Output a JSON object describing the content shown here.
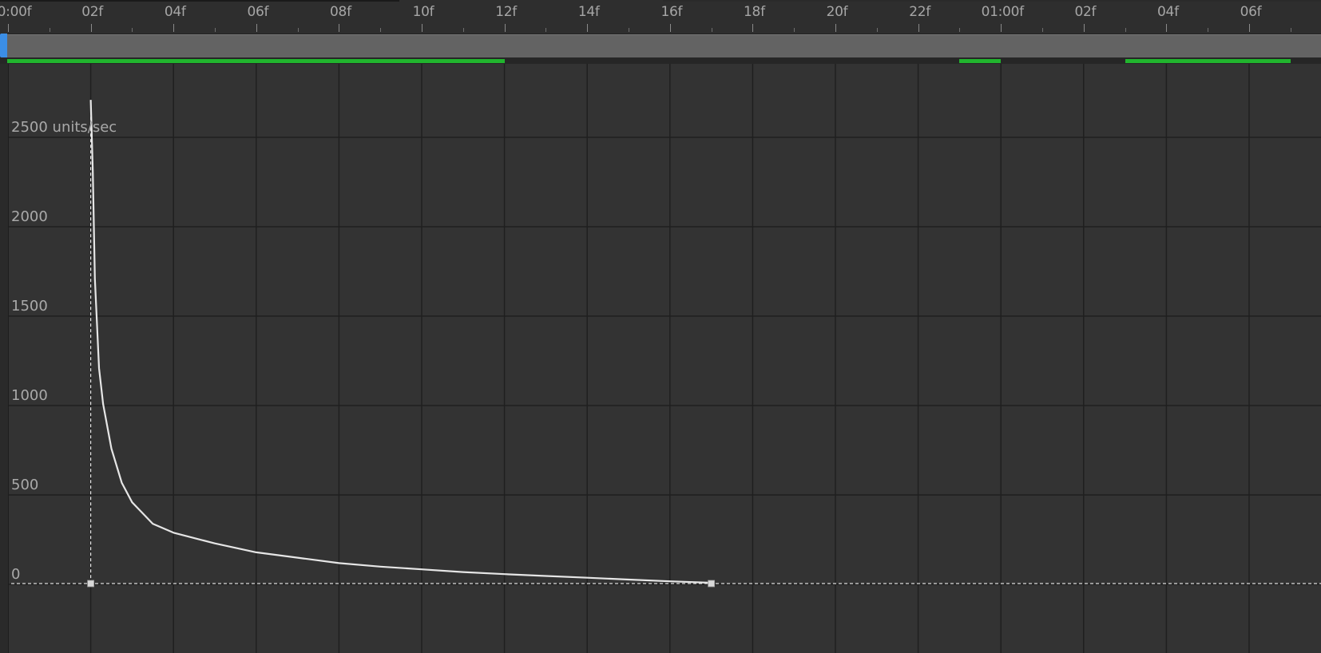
{
  "ruler": {
    "labels": [
      "0:00f",
      "02f",
      "04f",
      "06f",
      "08f",
      "10f",
      "12f",
      "14f",
      "16f",
      "18f",
      "20f",
      "22f",
      "01:00f",
      "02f",
      "04f",
      "06f"
    ]
  },
  "work_area": {
    "handle_color": "#3b8ee6",
    "bar_color": "#636363"
  },
  "cache": {
    "color": "#21b52e"
  },
  "graph": {
    "y_labels": [
      "2500 units/sec",
      "2000",
      "1500",
      "1000",
      "500",
      "0"
    ],
    "curve_color": "#e6e6e6"
  },
  "chart_data": {
    "type": "line",
    "xlabel": "",
    "ylabel": "units/sec",
    "ylim": [
      0,
      2500
    ],
    "x_unit": "frames",
    "keyframes": [
      {
        "frame": 2,
        "value": 0
      },
      {
        "frame": 17,
        "value": 0
      }
    ],
    "series": [
      {
        "x": [
          2,
          2.05,
          2.1,
          2.2,
          2.3,
          2.5,
          2.75,
          3,
          3.5,
          4,
          5,
          6,
          7,
          8,
          9,
          10,
          11,
          12,
          13,
          14,
          15,
          16,
          17
        ],
        "values": [
          2700,
          2300,
          1700,
          1200,
          1000,
          750,
          560,
          450,
          330,
          280,
          220,
          170,
          140,
          110,
          90,
          75,
          60,
          48,
          38,
          28,
          18,
          8,
          0
        ]
      }
    ]
  }
}
